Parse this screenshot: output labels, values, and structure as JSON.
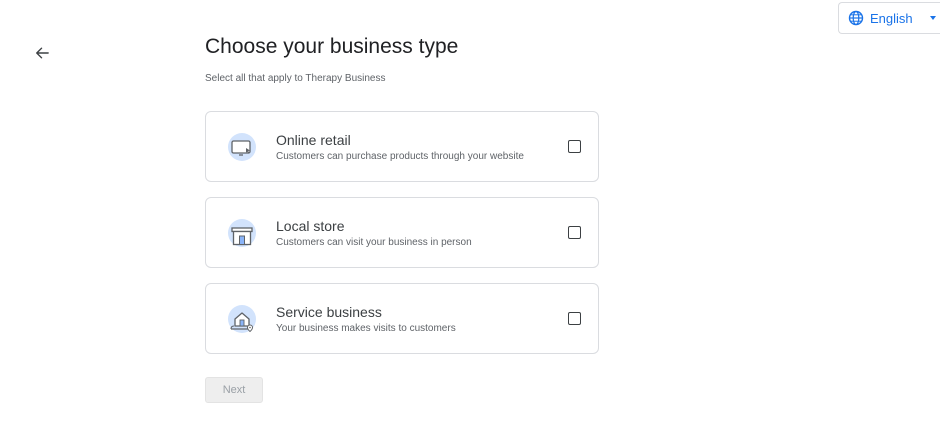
{
  "header": {
    "back_icon": "arrow-back-icon",
    "language": {
      "icon": "globe-icon",
      "label": "English"
    }
  },
  "main": {
    "title": "Choose your business type",
    "subtitle": "Select all that apply to Therapy Business"
  },
  "options": [
    {
      "icon": "online-retail-icon",
      "label": "Online retail",
      "description": "Customers can purchase products through your website",
      "checked": false
    },
    {
      "icon": "storefront-icon",
      "label": "Local store",
      "description": "Customers can visit your business in person",
      "checked": false
    },
    {
      "icon": "service-home-icon",
      "label": "Service business",
      "description": "Your business makes visits to customers",
      "checked": false
    }
  ],
  "footer": {
    "next_label": "Next",
    "next_enabled": false
  },
  "colors": {
    "accent": "#1a73e8",
    "icon_bg": "#d2e3fc",
    "border": "#dadce0"
  }
}
